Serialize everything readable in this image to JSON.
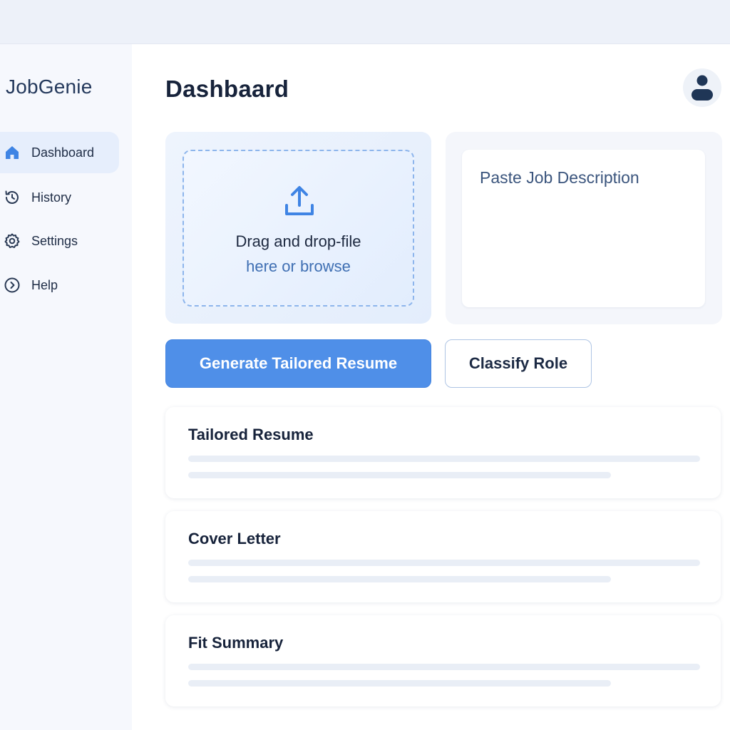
{
  "app": {
    "brand": "JobGenie"
  },
  "sidebar": {
    "items": [
      {
        "label": "Dashboard",
        "icon": "home-icon",
        "active": true
      },
      {
        "label": "History",
        "icon": "history-icon",
        "active": false
      },
      {
        "label": "Settings",
        "icon": "gear-icon",
        "active": false
      },
      {
        "label": "Help",
        "icon": "chevron-right-circle-icon",
        "active": false
      }
    ]
  },
  "header": {
    "title": "Dashbaard",
    "avatar_icon": "user-icon"
  },
  "upload": {
    "icon": "upload-icon",
    "primary_text": "Drag and drop-file",
    "browse_text": "here or browse"
  },
  "job_description": {
    "placeholder": "Paste Job Description"
  },
  "actions": {
    "generate_label": "Generate Tailored Resume",
    "classify_label": "Classify Role"
  },
  "results": [
    {
      "title": "Tailored Resume"
    },
    {
      "title": "Cover Letter"
    },
    {
      "title": "Fit Summary"
    }
  ],
  "colors": {
    "accent": "#4f8fe8",
    "link": "#3f6fb3",
    "active_nav_bg": "#e6eefc",
    "sidebar_bg": "#f6f8fd",
    "topbar_bg": "#edf1f9"
  }
}
